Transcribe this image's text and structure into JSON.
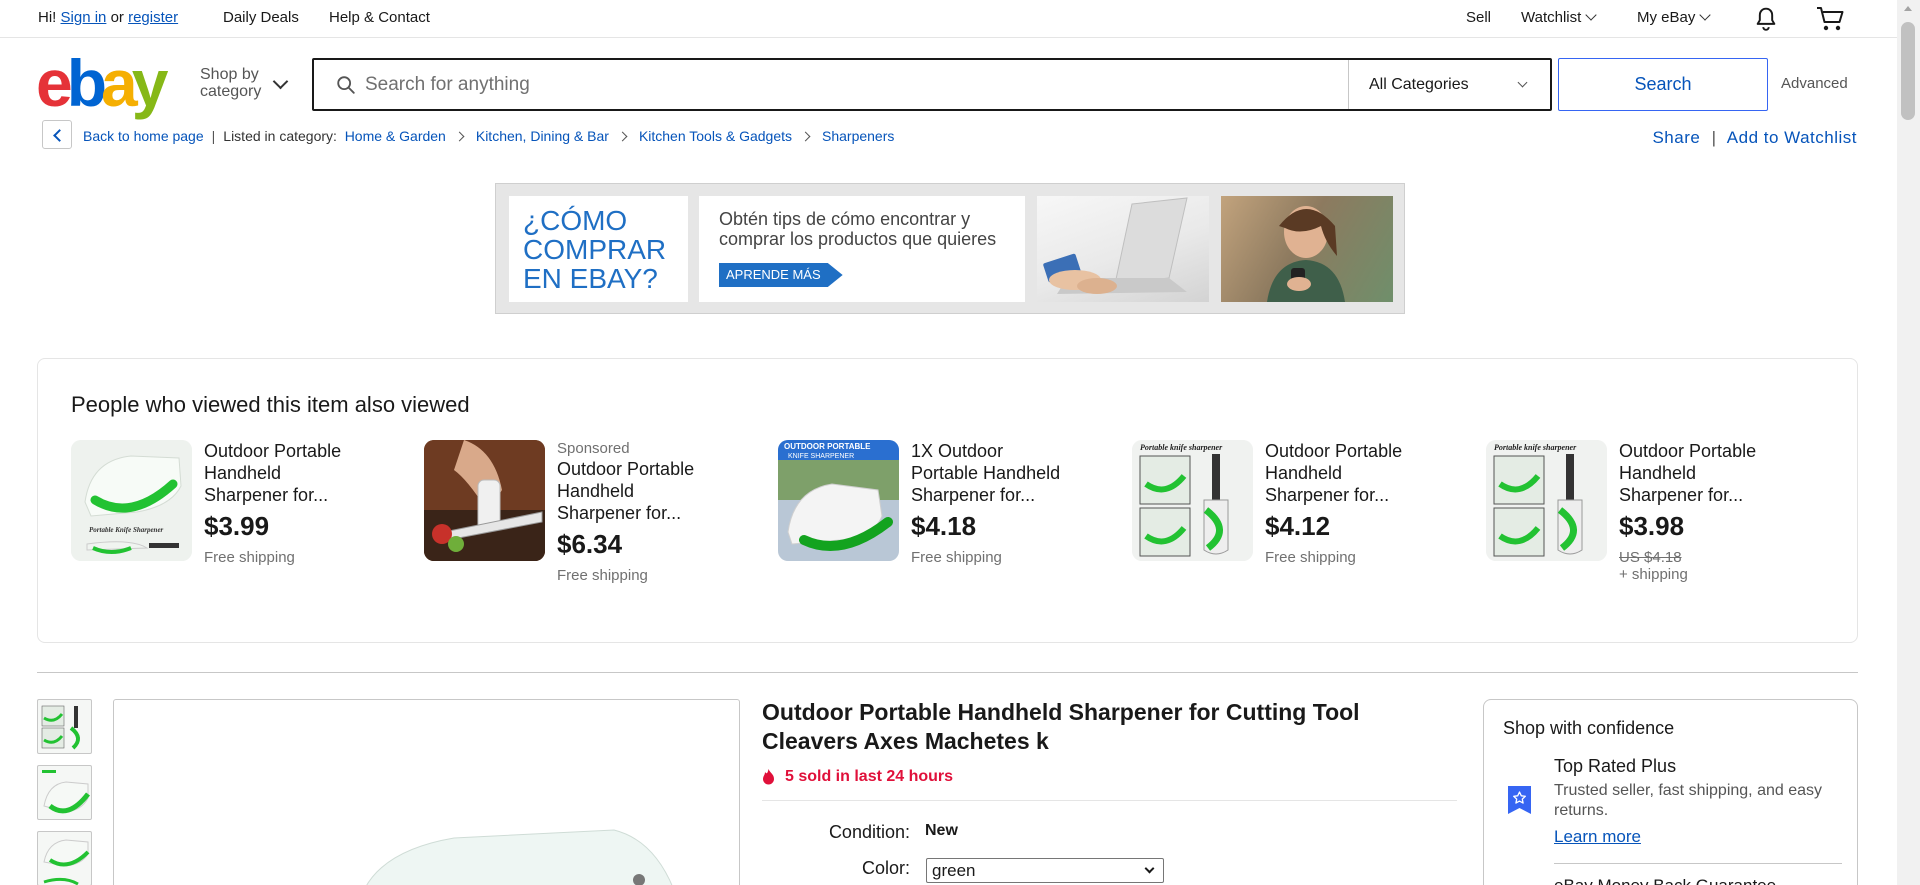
{
  "topbar": {
    "greeting": "Hi!",
    "signin": "Sign in",
    "or": "or",
    "register": "register",
    "daily_deals": "Daily Deals",
    "help_contact": "Help & Contact",
    "sell": "Sell",
    "watchlist": "Watchlist",
    "my_ebay": "My eBay",
    "bell_icon": "bell-icon",
    "cart_icon": "cart-icon"
  },
  "header": {
    "logo": {
      "e": "e",
      "b": "b",
      "a": "a",
      "y": "y"
    },
    "shop_by_category": [
      "Shop by",
      "category"
    ],
    "search_placeholder": "Search for anything",
    "category_select": "All Categories",
    "search_button": "Search",
    "advanced": "Advanced"
  },
  "breadcrumb": {
    "back": "Back to home page",
    "listed_in": "Listed in category:",
    "items": [
      "Home & Garden",
      "Kitchen, Dining & Bar",
      "Kitchen Tools & Gadgets",
      "Sharpeners"
    ],
    "share": "Share",
    "add_to_watchlist": "Add to Watchlist"
  },
  "banner": {
    "headline": [
      "¿CÓMO",
      "COMPRAR",
      "EN EBAY?"
    ],
    "subtitle": [
      "Obtén tips de cómo encontrar y",
      "comprar los  productos que quieres"
    ],
    "cta": "APRENDE MÁS"
  },
  "also_viewed": {
    "title": "People who viewed this item also viewed",
    "items": [
      {
        "sponsored": "",
        "name": [
          "Outdoor Portable",
          "Handheld",
          "Sharpener for..."
        ],
        "price": "$3.99",
        "shipping": "Free shipping",
        "orig": ""
      },
      {
        "sponsored": "Sponsored",
        "name": [
          "Outdoor Portable",
          "Handheld",
          "Sharpener for..."
        ],
        "price": "$6.34",
        "shipping": "Free shipping",
        "orig": ""
      },
      {
        "sponsored": "",
        "name": [
          "1X Outdoor",
          "Portable Handheld",
          "Sharpener for..."
        ],
        "price": "$4.18",
        "shipping": "Free shipping",
        "orig": ""
      },
      {
        "sponsored": "",
        "name": [
          "Outdoor Portable",
          "Handheld",
          "Sharpener for..."
        ],
        "price": "$4.12",
        "shipping": "Free shipping",
        "orig": ""
      },
      {
        "sponsored": "",
        "name": [
          "Outdoor Portable",
          "Handheld",
          "Sharpener for..."
        ],
        "price": "$3.98",
        "shipping": "+ shipping",
        "orig": "US $4.18"
      }
    ],
    "image_labels": {
      "portable_knife_sharpener": "Portable Knife Sharpener",
      "portable_knife_sharpener_lc": "Portable knife sharpener",
      "outdoor_portable": "OUTDOOR PORTABLE",
      "knife_sharpener": "KNIFE SHARPENER"
    }
  },
  "item": {
    "title": [
      "Outdoor Portable Handheld Sharpener for Cutting Tool",
      "Cleavers Axes Machetes k"
    ],
    "sold": "5 sold in last 24 hours",
    "condition_label": "Condition:",
    "condition_value": "New",
    "color_label": "Color:",
    "color_value": "green"
  },
  "confidence": {
    "title": "Shop with confidence",
    "top_rated": "Top Rated Plus",
    "top_rated_desc": "Trusted seller, fast shipping, and easy returns.",
    "learn_more": "Learn more",
    "next_heading": "eBay Money Back Guarantee"
  },
  "colors": {
    "link": "#0654ba",
    "accent_blue": "#3665f3",
    "sold_red": "#e0103a",
    "sharpener_green": "#22c232"
  }
}
